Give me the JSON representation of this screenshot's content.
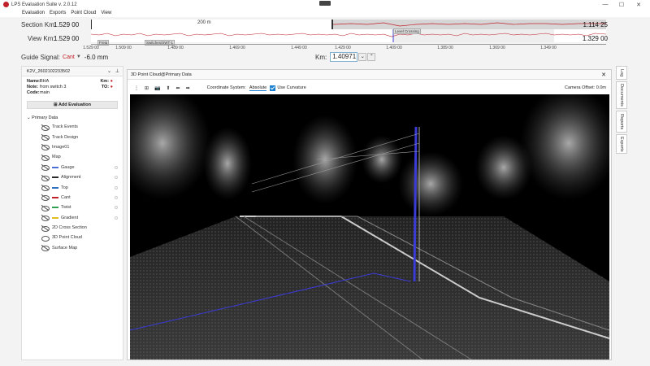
{
  "window": {
    "title": "LPS Evaluation Suite v. 2.0.12",
    "minimize": "—",
    "maximize": "☐",
    "close": "✕"
  },
  "menu": [
    "Evaluation",
    "Exports",
    "Point Cloud",
    "View"
  ],
  "section": {
    "label": "Section Km:",
    "start": "1.529 00",
    "end": "1.114 25",
    "window_label": "200 m"
  },
  "view": {
    "label": "View Km:",
    "start": "1.529 00",
    "end": "1.329 00",
    "tags": [
      "Freig",
      "Switches/SWT-1",
      "Level Crossing"
    ]
  },
  "axis_ticks": [
    "1.529 00",
    "1.509 00",
    "1.489 00",
    "1.469 00",
    "1.449 00",
    "1.429 00",
    "1.409 00",
    "1.389 00",
    "1.369 00",
    "1.349 00"
  ],
  "guide": {
    "label": "Guide Signal:",
    "selected": "Cant",
    "value": "-6.0 mm"
  },
  "km": {
    "label": "Km:",
    "value": "1.40971"
  },
  "left": {
    "header": "K2V_2602102233502",
    "info": [
      {
        "k": "Name:",
        "v": "BHA",
        "rk": "Km:"
      },
      {
        "k": "Note:",
        "v": "from switch 3",
        "rk": "TO:"
      },
      {
        "k": "Code:",
        "v": "main",
        "rk": ""
      }
    ],
    "add_eval": "Add Evaluation",
    "tree_root": "Primary Data",
    "items": [
      {
        "label": "Track Events",
        "hidden": true,
        "color": ""
      },
      {
        "label": "Track Design",
        "hidden": true,
        "color": ""
      },
      {
        "label": "Image01",
        "hidden": true,
        "color": ""
      },
      {
        "label": "Map",
        "hidden": true,
        "color": ""
      },
      {
        "label": "Gauge",
        "hidden": true,
        "color": "#4a6fd0"
      },
      {
        "label": "Alignment",
        "hidden": true,
        "color": "#2a2a2a"
      },
      {
        "label": "Top",
        "hidden": true,
        "color": "#3070c0"
      },
      {
        "label": "Cant",
        "hidden": true,
        "color": "#c0202a"
      },
      {
        "label": "Twist",
        "hidden": true,
        "color": "#30a050"
      },
      {
        "label": "Gradient",
        "hidden": true,
        "color": "#e0c020"
      },
      {
        "label": "2D Cross Section",
        "hidden": true,
        "color": ""
      },
      {
        "label": "3D Point Cloud",
        "hidden": false,
        "color": ""
      },
      {
        "label": "Surface Map",
        "hidden": true,
        "color": ""
      }
    ]
  },
  "viewer": {
    "tab": "3D Point Cloud@Primary Data",
    "tool_buttons": [
      "⋮",
      "⊞",
      "📷",
      "⬆",
      "⬅",
      "➡"
    ],
    "coord_label": "Coordinate System:",
    "coord_value": "Absolute",
    "curvature_label": "Use Curvature",
    "camera_offset": "Camera Offset: 0.0m"
  },
  "right_tabs": [
    "Log",
    "Documents",
    "Reports",
    "Exports"
  ],
  "colors": {
    "accent": "#1a7fd0",
    "red": "#c0202a",
    "rail_blue": "#3b3bd6"
  }
}
